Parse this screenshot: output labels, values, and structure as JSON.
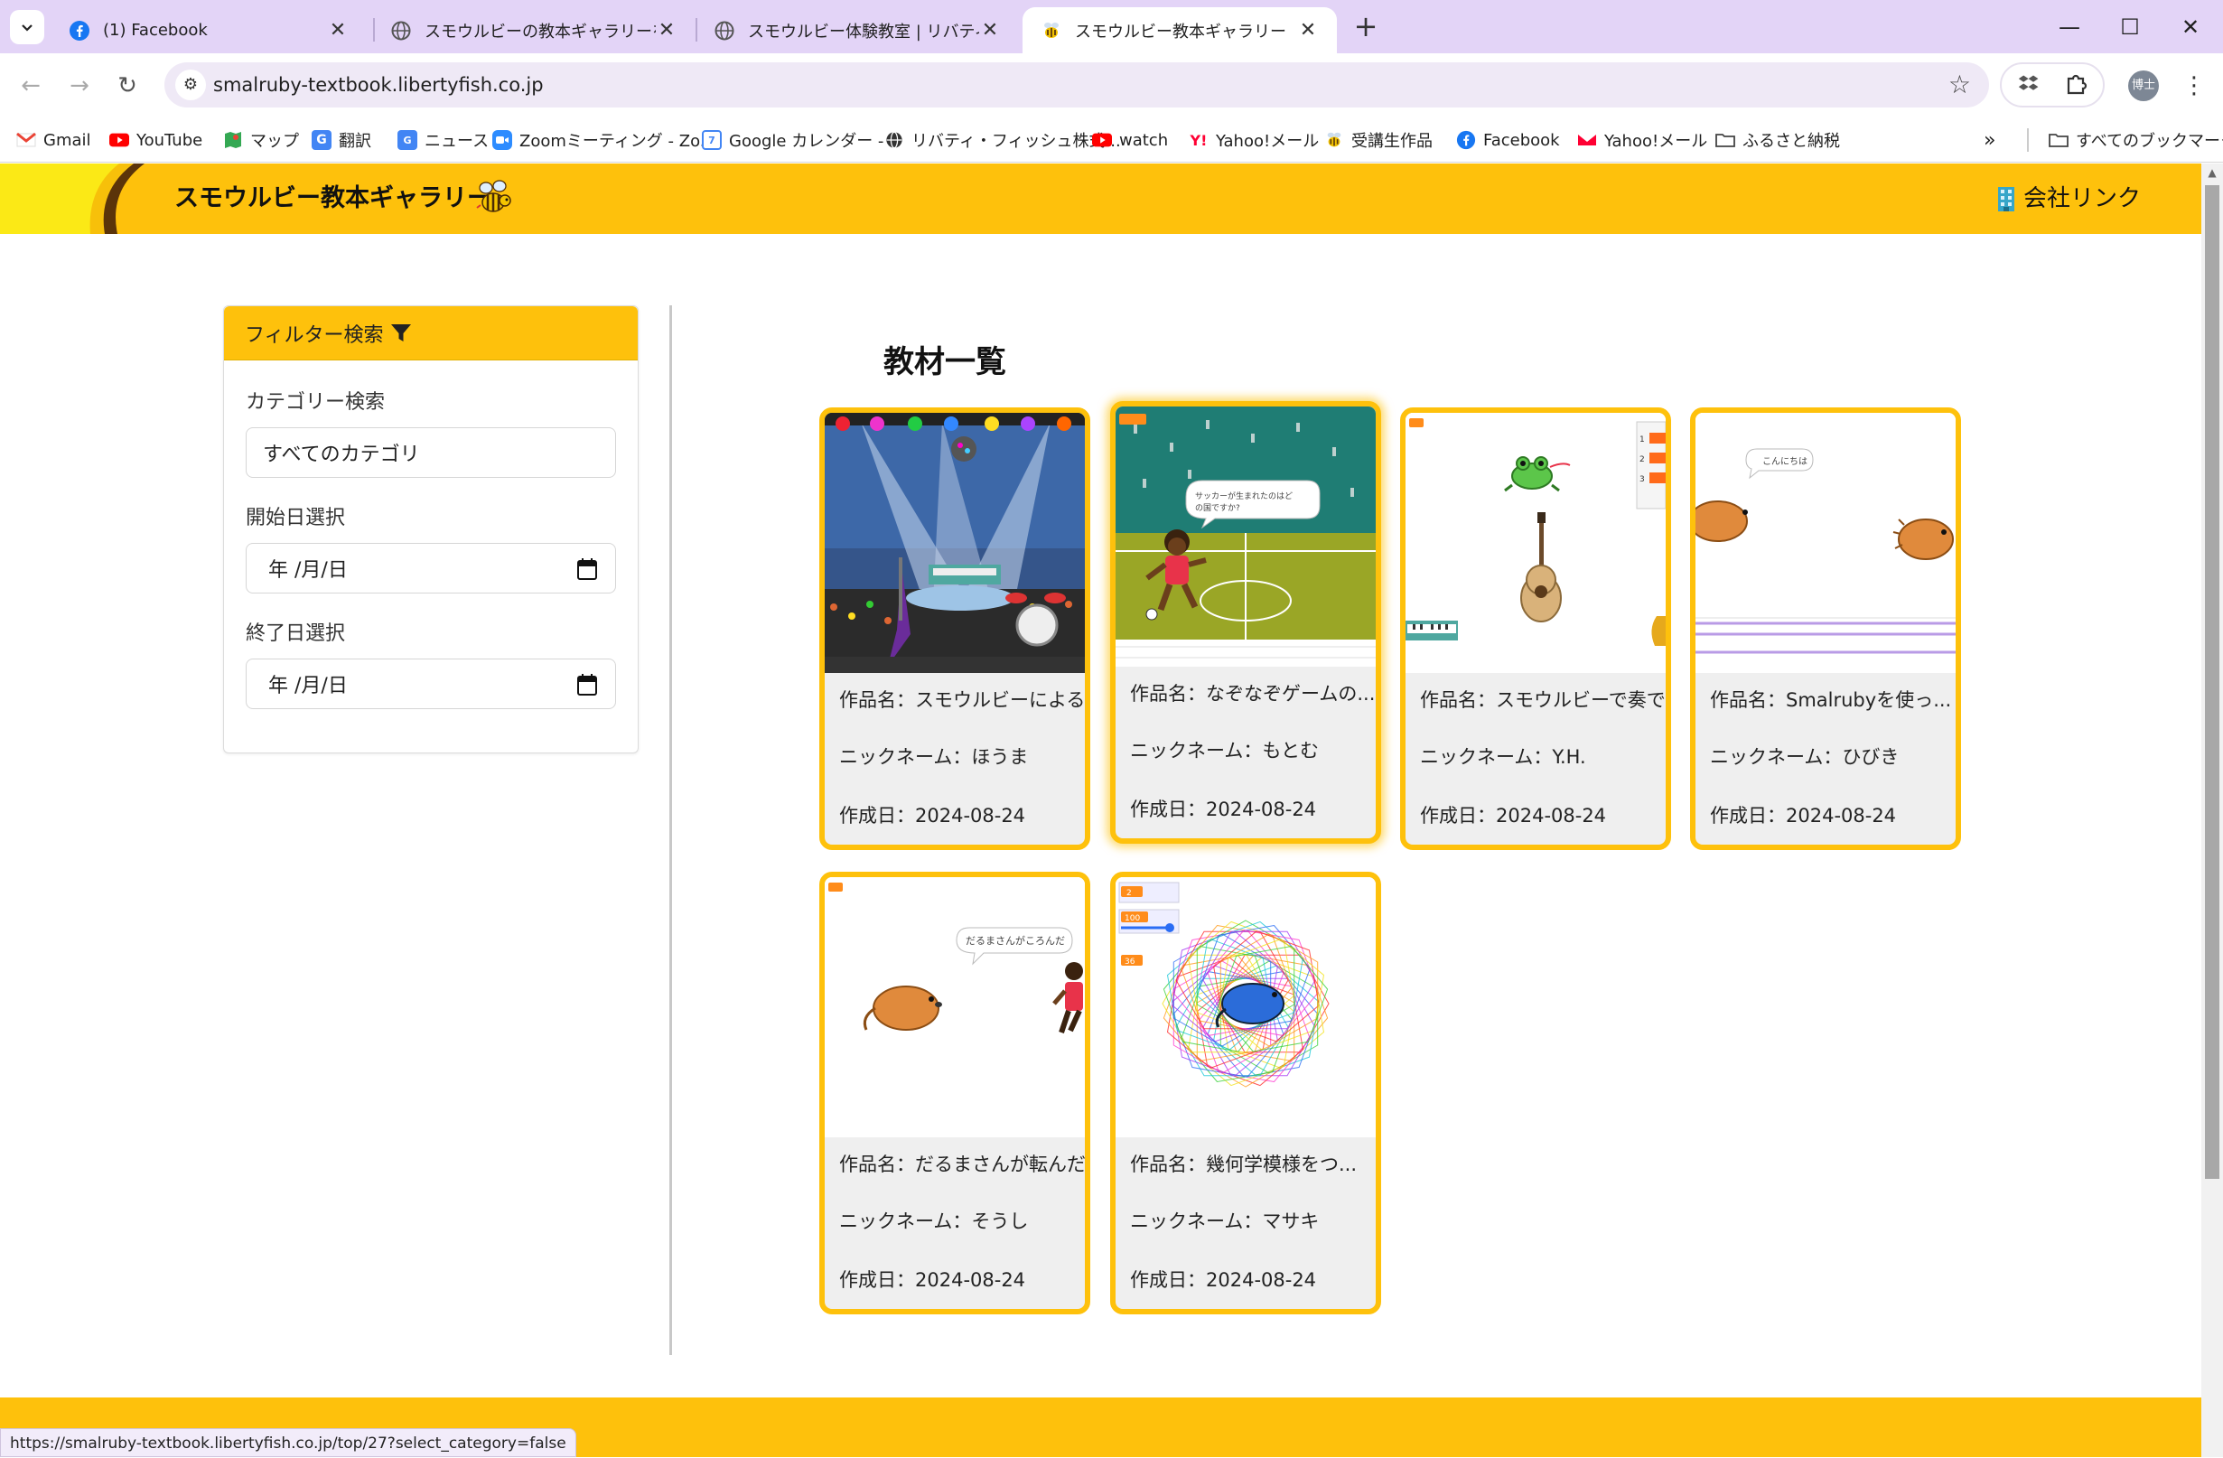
{
  "browser": {
    "tabs": [
      {
        "title": "(1) Facebook",
        "icon": "facebook-icon"
      },
      {
        "title": "スモウルビーの教本ギャラリーを公開し",
        "icon": "globe-icon"
      },
      {
        "title": "スモウルビー体験教室 | リバティフィッ",
        "icon": "globe-icon"
      },
      {
        "title": "スモウルビー教本ギャラリー",
        "icon": "bee-icon"
      }
    ],
    "url": "smalruby-textbook.libertyfish.co.jp",
    "profile_label": "博士",
    "bookmarks": [
      {
        "label": "Gmail",
        "icon": "gmail-icon"
      },
      {
        "label": "YouTube",
        "icon": "youtube-icon"
      },
      {
        "label": "マップ",
        "icon": "maps-icon"
      },
      {
        "label": "翻訳",
        "icon": "translate-icon"
      },
      {
        "label": "ニュース",
        "icon": "news-icon"
      },
      {
        "label": "Zoomミーティング - Zo...",
        "icon": "zoom-icon"
      },
      {
        "label": "Google カレンダー -",
        "icon": "calendar-icon"
      },
      {
        "label": "リバティ・フィッシュ株式...",
        "icon": "globe-icon"
      },
      {
        "label": "watch",
        "icon": "youtube-icon"
      },
      {
        "label": "Yahoo!メール",
        "icon": "yahoo-icon"
      },
      {
        "label": "受講生作品",
        "icon": "bee-icon"
      },
      {
        "label": "Facebook",
        "icon": "facebook-icon"
      },
      {
        "label": "Yahoo!メール",
        "icon": "yahoo-mail-icon"
      },
      {
        "label": "ふるさと納税",
        "icon": "folder-icon"
      }
    ],
    "all_bookmarks_label": "すべてのブックマーク",
    "status_url": "https://smalruby-textbook.libertyfish.co.jp/top/27?select_category=false"
  },
  "site": {
    "title": "スモウルビー教本ギャラリー",
    "company_link": "会社リンク",
    "brand_color": "#fec10c"
  },
  "filter": {
    "header": "フィルター検索",
    "category_label": "カテゴリー検索",
    "category_value": "すべてのカテゴリ",
    "start_label": "開始日選択",
    "start_value": "年 /月/日",
    "end_label": "終了日選択",
    "end_value": "年 /月/日"
  },
  "gallery": {
    "title": "教材一覧",
    "cards": [
      {
        "name": "作品名：スモウルビーによる...",
        "nickname": "ニックネーム：ほうま",
        "date": "作成日：2024-08-24"
      },
      {
        "name": "作品名：なぞなぞゲームの...",
        "nickname": "ニックネーム：もとむ",
        "date": "作成日：2024-08-24",
        "bubble": "サッカーが生まれたのはどの国ですか?"
      },
      {
        "name": "作品名：スモウルビーで奏で...",
        "nickname": "ニックネーム：Y.H.",
        "date": "作成日：2024-08-24"
      },
      {
        "name": "作品名：Smalrubyを使っ...",
        "nickname": "ニックネーム：ひびき",
        "date": "作成日：2024-08-24",
        "bubble": "こんにちは"
      },
      {
        "name": "作品名：だるまさんが転んだ",
        "nickname": "ニックネーム：そうし",
        "date": "作成日：2024-08-24",
        "bubble": "だるまさんがころんだ"
      },
      {
        "name": "作品名：幾何学模様をつ...",
        "nickname": "ニックネーム：マサキ",
        "date": "作成日：2024-08-24",
        "monitors": [
          "2",
          "100",
          "36"
        ]
      }
    ]
  }
}
